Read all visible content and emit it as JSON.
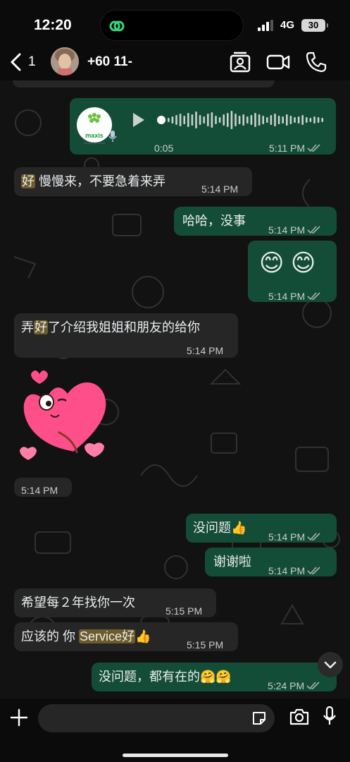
{
  "status": {
    "time": "12:20",
    "network": "4G",
    "battery": "30"
  },
  "header": {
    "back_count": "1",
    "contact_name": "+60 11-"
  },
  "messages": {
    "voice": {
      "logo_text": "maxis",
      "logo_sub": "Always Be Ahead",
      "duration": "0:05",
      "time": "5:11 PM"
    },
    "m1": {
      "hl": "好",
      "text": " 慢慢来，不要急着来弄",
      "time": "5:14 PM"
    },
    "m2": {
      "text": "哈哈，没事",
      "time": "5:14 PM"
    },
    "m3": {
      "text": "😊 😊",
      "time": "5:14 PM"
    },
    "m4": {
      "pre": "弄",
      "hl": "好",
      "post": "了介绍我姐姐和朋友的给你",
      "time": "5:14 PM"
    },
    "sticker": {
      "time": "5:14 PM"
    },
    "m5": {
      "text": "没问题👍",
      "time": "5:14 PM"
    },
    "m6": {
      "text": "谢谢啦",
      "time": "5:14 PM"
    },
    "m7": {
      "text": "希望每２年找你一次",
      "time": "5:15 PM"
    },
    "m8": {
      "pre": "应该的 你 ",
      "hl": "Service好",
      "post": "👍",
      "time": "5:15 PM"
    },
    "m9": {
      "text": "没问题，都有在的🤗🤗",
      "time": "5:24 PM"
    }
  },
  "colors": {
    "outgoing": "#144d37",
    "incoming": "#262626",
    "background": "#121212",
    "read_ticks": "#a8b3ae"
  },
  "icons": [
    "link-icon",
    "signal-icon",
    "back-chevron-icon",
    "contact-card-icon",
    "video-call-icon",
    "phone-icon",
    "play-icon",
    "microphone-icon",
    "scroll-down-icon",
    "plus-icon",
    "sticker-icon",
    "camera-icon"
  ]
}
